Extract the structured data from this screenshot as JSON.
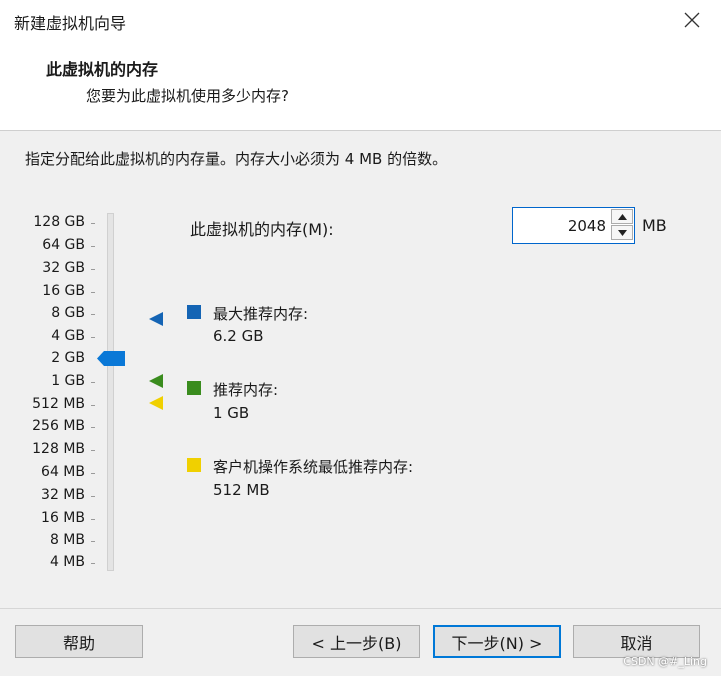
{
  "window": {
    "title": "新建虚拟机向导"
  },
  "header": {
    "title": "此虚拟机的内存",
    "subtitle": "您要为此虚拟机使用多少内存?"
  },
  "instruction": "指定分配给此虚拟机的内存量。内存大小必须为 4 MB 的倍数。",
  "memory": {
    "label": "此虚拟机的内存(M):",
    "value": "2048",
    "unit": "MB"
  },
  "scale": {
    "labels": [
      "128 GB",
      "64 GB",
      "32 GB",
      "16 GB",
      "8 GB",
      "4 GB",
      "2 GB",
      "1 GB",
      "512 MB",
      "256 MB",
      "128 MB",
      "64 MB",
      "32 MB",
      "16 MB",
      "8 MB",
      "4 MB"
    ],
    "selected": "2 GB"
  },
  "legend": [
    {
      "label": "最大推荐内存:",
      "value": "6.2 GB",
      "color": "#1464b4"
    },
    {
      "label": "推荐内存:",
      "value": "1 GB",
      "color": "#3a8c1e"
    },
    {
      "label": "客户机操作系统最低推荐内存:",
      "value": "512 MB",
      "color": "#f0d000"
    }
  ],
  "buttons": {
    "help": "帮助",
    "back": "< 上一步(B)",
    "next": "下一步(N) >",
    "cancel": "取消"
  },
  "watermark": "CSDN @#_Ling",
  "colors": {
    "accent": "#0078d7",
    "thumb": "#0a78d7"
  }
}
